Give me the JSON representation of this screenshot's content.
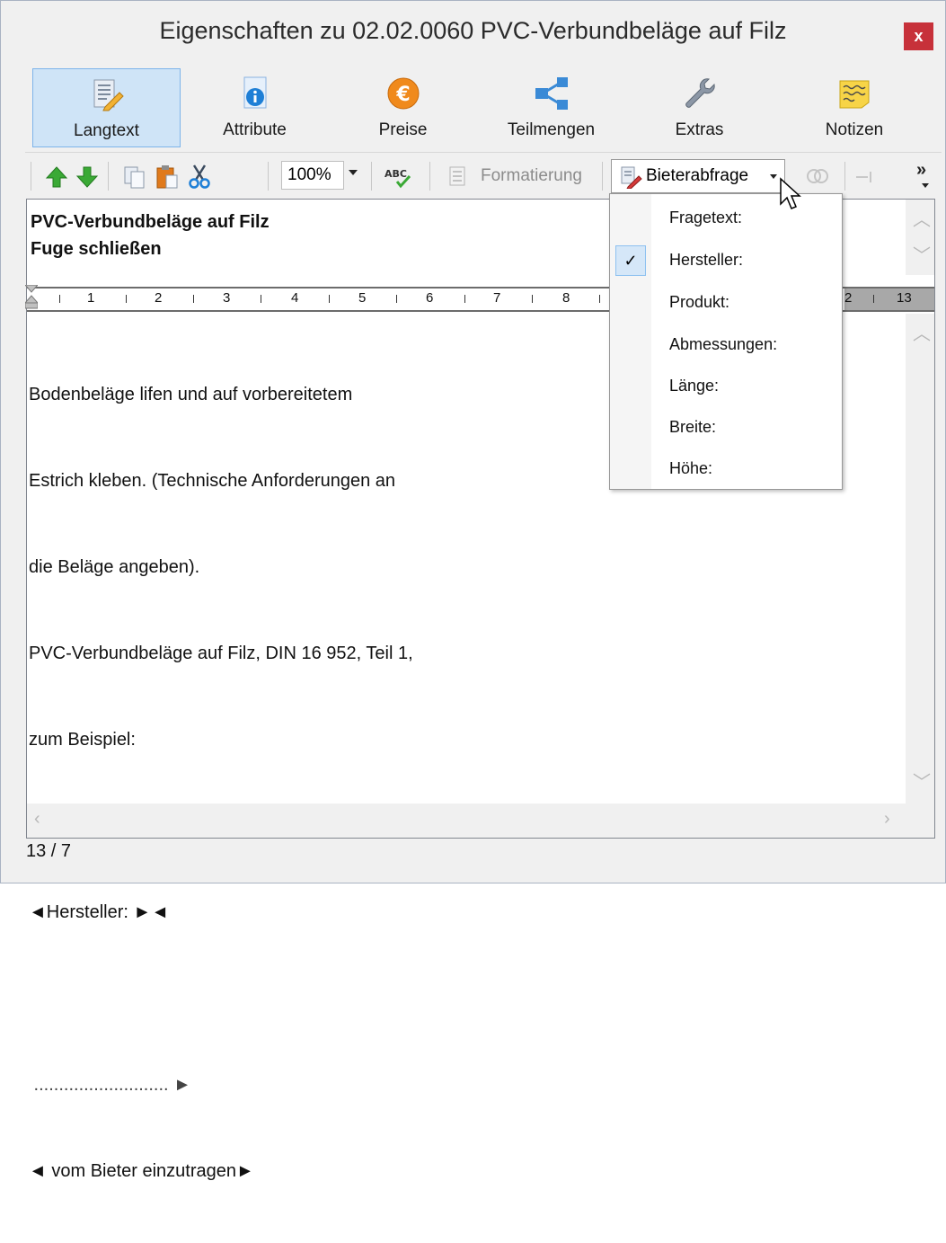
{
  "window": {
    "title": "Eigenschaften zu 02.02.0060 PVC-Verbundbeläge auf Filz",
    "close_label": "x"
  },
  "ribbon": {
    "tabs": [
      {
        "label": "Langtext",
        "icon": "edit-document-icon"
      },
      {
        "label": "Attribute",
        "icon": "info-document-icon"
      },
      {
        "label": "Preise",
        "icon": "euro-icon"
      },
      {
        "label": "Teilmengen",
        "icon": "share-nodes-icon"
      },
      {
        "label": "Extras",
        "icon": "wrench-icon"
      },
      {
        "label": "Notizen",
        "icon": "sticky-note-icon"
      }
    ],
    "active_tab": "Langtext"
  },
  "toolbar": {
    "zoom_value": "100%",
    "spellcheck_label": "ABC",
    "format_label": "Formatierung",
    "bieter_label": "Bieterabfrage",
    "overflow_label": "»"
  },
  "editor": {
    "short_text": [
      "PVC-Verbundbeläge auf Filz",
      "Fuge schließen"
    ],
    "ruler_numbers": [
      "1",
      "2",
      "3",
      "4",
      "5",
      "6",
      "7",
      "8",
      "2",
      "13"
    ],
    "long_text": [
      "Bodenbeläge lifen und auf vorbereitetem",
      "Estrich kleben. (Technische Anforderungen an",
      "die Beläge angeben).",
      "PVC-Verbundbeläge auf Filz, DIN 16 952, Teil 1,",
      "zum Beispiel:",
      "",
      "◄Hersteller: ►◄",
      "",
      " ........................... ►",
      "◄ vom Bieter einzutragen►"
    ]
  },
  "status": {
    "position": "13 / 7"
  },
  "dropdown": {
    "items": [
      {
        "label": "Fragetext:",
        "checked": false
      },
      {
        "label": "Hersteller:",
        "checked": true
      },
      {
        "label": "Produkt:",
        "checked": false
      },
      {
        "label": "Abmessungen:",
        "checked": false
      },
      {
        "label": "Länge:",
        "checked": false
      },
      {
        "label": "Breite:",
        "checked": false
      },
      {
        "label": "Höhe:",
        "checked": false
      }
    ],
    "checkmark": "✓"
  },
  "colors": {
    "accent": "#cfe4f7",
    "close": "#c7313a",
    "arrow_green": "#3aa935",
    "euro_orange": "#f08a1c"
  }
}
